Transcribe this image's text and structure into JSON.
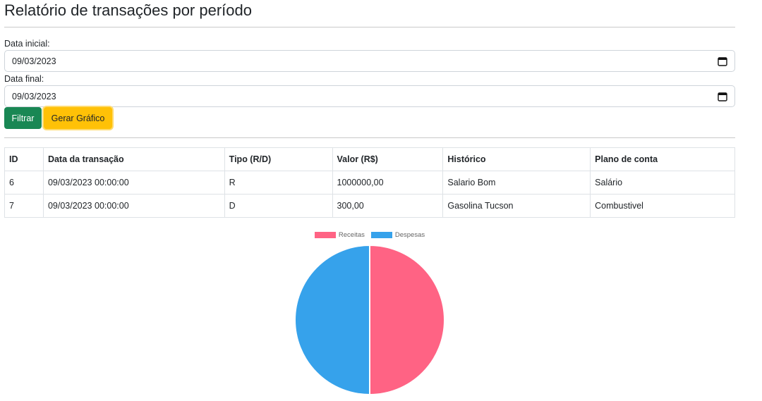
{
  "page": {
    "title": "Relatório de transações por período"
  },
  "filters": {
    "start_label": "Data inicial:",
    "start_value": "09/03/2023",
    "end_label": "Data final:",
    "end_value": "09/03/2023",
    "calendar_icon": "calendar-icon"
  },
  "buttons": {
    "filter": "Filtrar",
    "chart": "Gerar Gráfico"
  },
  "table": {
    "headers": [
      "ID",
      "Data da transação",
      "Tipo (R/D)",
      "Valor (R$)",
      "Histórico",
      "Plano de conta"
    ],
    "rows": [
      [
        "6",
        "09/03/2023 00:00:00",
        "R",
        "1000000,00",
        "Salario Bom",
        "Salário"
      ],
      [
        "7",
        "09/03/2023 00:00:00",
        "D",
        "300,00",
        "Gasolina Tucson",
        "Combustivel"
      ]
    ]
  },
  "chart_data": {
    "type": "pie",
    "categories": [
      "Receitas",
      "Despesas"
    ],
    "values": [
      1,
      1
    ],
    "colors": [
      "#ff6384",
      "#36a2eb"
    ],
    "legend": "top"
  }
}
